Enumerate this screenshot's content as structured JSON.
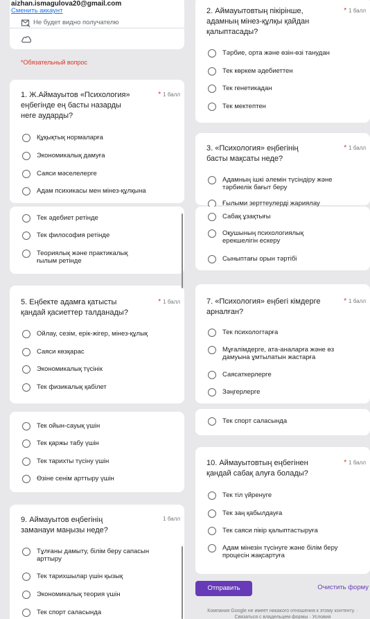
{
  "account": {
    "email": "aizhan.ismagulova20@gmail.com",
    "switch_label": "Сменить аккаунт",
    "hidden_note": "Не будет видно получателю"
  },
  "required_note": "*Обязательный вопрос",
  "points_label": "1 балл",
  "questions": {
    "q1": {
      "title": "1. Ж.Аймауытов «Психология» еңбегінде ең басты назарды неге аударды?",
      "options": [
        "Құқықтық нормаларға",
        "Экономикалық дамуға",
        "Саяси мәселелерге",
        "Адам психикасы мен мінез-құлқына"
      ]
    },
    "q1_cont": {
      "options": [
        "Тек әдебиет ретінде",
        "Тек философия ретінде",
        "Теориялық және практикалық ғылым ретінде"
      ]
    },
    "q5": {
      "title": "5. Еңбекте адамға қатысты қандай қасиеттер талданады?",
      "options": [
        "Ойлау, сезім, ерік-жігер, мінез-құлық",
        "Саяси көзқарас",
        "Экономикалық түсінік",
        "Тек физикалық қабілет"
      ]
    },
    "q5_cont": {
      "options": [
        "Тек ойын-сауық үшін",
        "Тек қаржы табу үшін",
        "Тек тарихты түсіну үшін",
        "Өзіне сенім арттыру үшін"
      ]
    },
    "q9": {
      "title": "9. Аймауытов еңбегінің заманауи маңызы неде?",
      "options": [
        "Тұлғаны дамыту, білім беру сапасын арттыру",
        "Тек тарихшылар үшін қызық",
        "Экономикалық теория үшін",
        "Тек спорт саласында"
      ]
    },
    "q2": {
      "title": "2. Аймауытовтың пікірінше, адамның мінез-құлқы қайдан қалыптасады?",
      "options": [
        "Тәрбие, орта және өзін-өзі танудан",
        "Тек көркем әдебиеттен",
        "Тек генетикадан",
        "Тек мектептен"
      ]
    },
    "q3": {
      "title": "3. «Психология» еңбегінің басты мақсаты неде?",
      "options": [
        "Адамның ішкі әлемін түсіндіру және тәрбиелік бағыт беру",
        "Ғылыми зерттеулерді жариялау"
      ]
    },
    "q3_cont": {
      "options": [
        "Сабақ ұзақтығы",
        "Оқушының психологиялық ерекшелігін ескеру",
        "Сыныптағы орын тәртібі"
      ]
    },
    "q7": {
      "title": "7. «Психология» еңбегі кімдерге арналған?",
      "options": [
        "Тек психологтарға",
        "Мұғалімдерге, ата-аналарға және өз дамуына ұмтылатын жастарға",
        "Саясаткерлерге",
        "Зәңгерлерге"
      ]
    },
    "q7_cont": {
      "options": [
        "Тек спорт саласында"
      ]
    },
    "q10": {
      "title": "10. Аймауытовтың еңбегінен қандай сабақ алуға болады?",
      "options": [
        "Тек тіл үйренуге",
        "Тек заң қабылдауға",
        "Тек саяси пікір қалыптастыруға",
        "Адам мінезін түсінуге және білім беру процесін жақсартуға"
      ]
    }
  },
  "actions": {
    "submit": "Отправить",
    "clear": "Очистить форму"
  },
  "footer": "Компания Google не имеет никакого отношения к этому контенту. · Связаться с владельцем формы · Условия"
}
